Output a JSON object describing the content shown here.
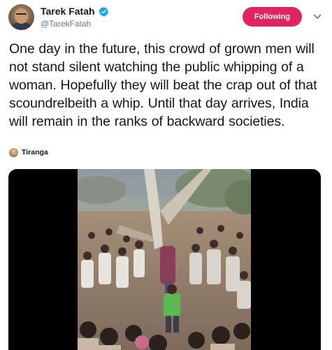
{
  "tweet": {
    "author": {
      "display_name": "Tarek Fatah",
      "handle": "@TarekFatah",
      "verified": true,
      "avatar_icon": "user-avatar"
    },
    "follow_button_label": "Following",
    "text": "One day in the future, this crowd of grown men will not stand silent watching the public whipping of a woman. Hopefully they will beat the crap out of that scoundrelbeith a whip. Until that day arrives, India will remain in the ranks of backward societies.",
    "source": {
      "name": "Tiranga",
      "icon": "source-avatar-icon"
    },
    "media": {
      "type": "video",
      "thumbnail_icon": "video-thumbnail"
    }
  },
  "colors": {
    "following_button": "#e0245e",
    "verified_badge": "#1da1f2",
    "handle_text": "#657786",
    "body_text": "#14171a"
  }
}
